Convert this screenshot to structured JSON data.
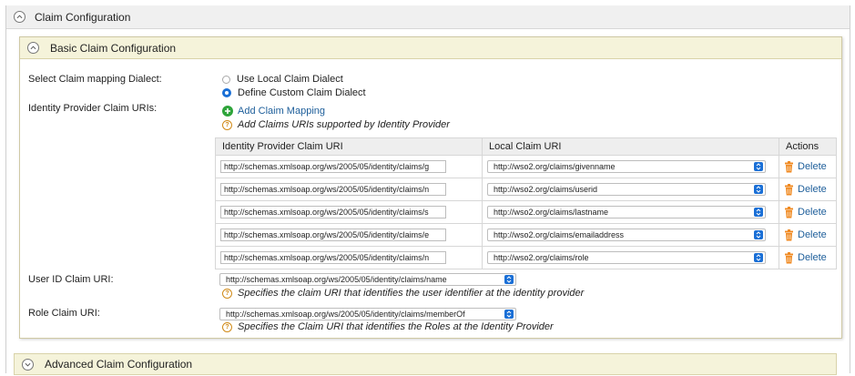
{
  "sections": {
    "claim_configuration": "Claim Configuration",
    "basic": "Basic Claim Configuration",
    "advanced": "Advanced Claim Configuration"
  },
  "dialect": {
    "label": "Select Claim mapping Dialect:",
    "options": [
      {
        "label": "Use Local Claim Dialect",
        "selected": false
      },
      {
        "label": "Define Custom Claim Dialect",
        "selected": true
      }
    ]
  },
  "idp_claims": {
    "label": "Identity Provider Claim URIs:",
    "add_link": "Add Claim Mapping",
    "help": "Add Claims URIs supported by Identity Provider",
    "columns": [
      "Identity Provider Claim URI",
      "Local Claim URI",
      "Actions"
    ],
    "delete_label": "Delete",
    "rows": [
      {
        "idp_uri": "http://schemas.xmlsoap.org/ws/2005/05/identity/claims/g",
        "local_uri": "http://wso2.org/claims/givenname"
      },
      {
        "idp_uri": "http://schemas.xmlsoap.org/ws/2005/05/identity/claims/n",
        "local_uri": "http://wso2.org/claims/userid"
      },
      {
        "idp_uri": "http://schemas.xmlsoap.org/ws/2005/05/identity/claims/s",
        "local_uri": "http://wso2.org/claims/lastname"
      },
      {
        "idp_uri": "http://schemas.xmlsoap.org/ws/2005/05/identity/claims/e",
        "local_uri": "http://wso2.org/claims/emailaddress"
      },
      {
        "idp_uri": "http://schemas.xmlsoap.org/ws/2005/05/identity/claims/n",
        "local_uri": "http://wso2.org/claims/role"
      }
    ]
  },
  "user_id": {
    "label": "User ID Claim URI:",
    "value": "http://schemas.xmlsoap.org/ws/2005/05/identity/claims/name",
    "help": "Specifies the claim URI that identifies the user identifier at the identity provider"
  },
  "role": {
    "label": "Role Claim URI:",
    "value": "http://schemas.xmlsoap.org/ws/2005/05/identity/claims/memberOf",
    "help": "Specifies the Claim URI that identifies the Roles at the Identity Provider"
  },
  "colors": {
    "accent": "#1a6fd6",
    "link": "#1d5e9a",
    "section_header": "#f5f3da",
    "add_icon": "#2ea43a",
    "help_icon": "#d08a17",
    "trash_icon": "#f08a22"
  }
}
